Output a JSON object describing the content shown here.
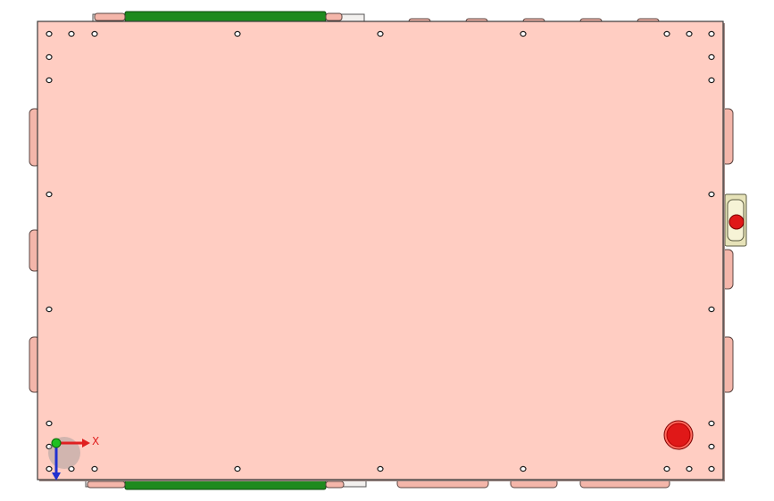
{
  "viewport": {
    "background": "#ffffff"
  },
  "panel": {
    "fill": "#ffcdc2",
    "edge": "#3a3a3a",
    "shadow": "#a08a86"
  },
  "rails": {
    "fill": "#1e8a1e",
    "edge": "#0c4a0c"
  },
  "tabs": {
    "fill": "#f4b6aa",
    "edge": "#5a4440"
  },
  "holes": {
    "fill": "#ffffff",
    "edge": "#1a1a1a"
  },
  "bracket": {
    "fill": "#e6e2b8",
    "edge": "#5a5a40"
  },
  "red_button": {
    "fill": "#e01818",
    "edge": "#7a0000"
  },
  "triad": {
    "x_label": "X",
    "x_color": "#e02020",
    "y_color": "#20c020",
    "z_color": "#2030d0",
    "origin_color": "#9a9a9a"
  }
}
